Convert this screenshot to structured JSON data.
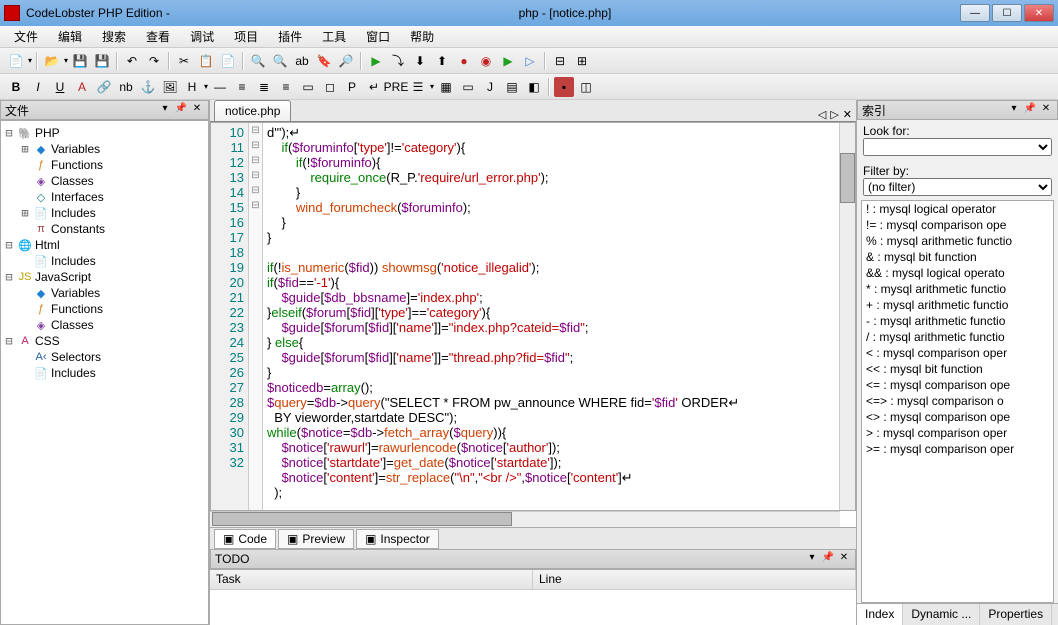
{
  "titlebar": {
    "app_name": "CodeLobster PHP Edition -",
    "doc_title": "php - [notice.php]"
  },
  "menu": [
    "文件",
    "编辑",
    "搜索",
    "查看",
    "调试",
    "项目",
    "插件",
    "工具",
    "窗口",
    "帮助"
  ],
  "left_panel": {
    "title": "文件",
    "tree": [
      {
        "level": 0,
        "exp": "-",
        "icon": "php",
        "label": "PHP"
      },
      {
        "level": 1,
        "exp": "+",
        "icon": "var",
        "label": "Variables"
      },
      {
        "level": 1,
        "exp": "",
        "icon": "func",
        "label": "Functions"
      },
      {
        "level": 1,
        "exp": "",
        "icon": "class",
        "label": "Classes"
      },
      {
        "level": 1,
        "exp": "",
        "icon": "intf",
        "label": "Interfaces"
      },
      {
        "level": 1,
        "exp": "+",
        "icon": "inc",
        "label": "Includes"
      },
      {
        "level": 1,
        "exp": "",
        "icon": "const",
        "label": "Constants"
      },
      {
        "level": 0,
        "exp": "-",
        "icon": "html",
        "label": "Html"
      },
      {
        "level": 1,
        "exp": "",
        "icon": "inc",
        "label": "Includes"
      },
      {
        "level": 0,
        "exp": "-",
        "icon": "js",
        "label": "JavaScript"
      },
      {
        "level": 1,
        "exp": "",
        "icon": "var",
        "label": "Variables"
      },
      {
        "level": 1,
        "exp": "",
        "icon": "func",
        "label": "Functions"
      },
      {
        "level": 1,
        "exp": "",
        "icon": "class",
        "label": "Classes"
      },
      {
        "level": 0,
        "exp": "-",
        "icon": "css",
        "label": "CSS"
      },
      {
        "level": 1,
        "exp": "",
        "icon": "sel",
        "label": "Selectors"
      },
      {
        "level": 1,
        "exp": "",
        "icon": "inc",
        "label": "Includes"
      }
    ]
  },
  "editor": {
    "tab": "notice.php",
    "first_line": 10,
    "lines": [
      {
        "n": 10,
        "fold": "",
        "html": "d'\");↵"
      },
      {
        "n": 11,
        "fold": "-",
        "html": "    if($foruminfo['type']!='category'){"
      },
      {
        "n": 12,
        "fold": "-",
        "html": "        if(!$foruminfo){"
      },
      {
        "n": 13,
        "fold": "",
        "html": "            require_once(R_P.'require/url_error.php');"
      },
      {
        "n": 14,
        "fold": "",
        "html": "        }"
      },
      {
        "n": 15,
        "fold": "",
        "html": "        wind_forumcheck($foruminfo);"
      },
      {
        "n": 16,
        "fold": "",
        "html": "    }"
      },
      {
        "n": 17,
        "fold": "",
        "html": "}"
      },
      {
        "n": 18,
        "fold": "",
        "html": ""
      },
      {
        "n": 19,
        "fold": "",
        "html": "if(!is_numeric($fid)) showmsg('notice_illegalid');"
      },
      {
        "n": 20,
        "fold": "-",
        "html": "if($fid=='-1'){"
      },
      {
        "n": 21,
        "fold": "",
        "html": "    $guide[$db_bbsname]='index.php';"
      },
      {
        "n": 22,
        "fold": "-",
        "html": "}elseif($forum[$fid]['type']=='category'){"
      },
      {
        "n": 23,
        "fold": "",
        "html": "    $guide[$forum[$fid]['name']]=\"index.php?cateid=$fid\";"
      },
      {
        "n": 24,
        "fold": "-",
        "html": "} else{"
      },
      {
        "n": 25,
        "fold": "",
        "html": "    $guide[$forum[$fid]['name']]=\"thread.php?fid=$fid\";"
      },
      {
        "n": 26,
        "fold": "",
        "html": "}"
      },
      {
        "n": 27,
        "fold": "",
        "html": "$noticedb=array();"
      },
      {
        "n": 28,
        "fold": "",
        "html": "$query=$db->query(\"SELECT * FROM pw_announce WHERE fid='$fid' ORDER↵"
      },
      {
        "n": "",
        "fold": "",
        "html": "  BY vieworder,startdate DESC\");"
      },
      {
        "n": 29,
        "fold": "-",
        "html": "while($notice=$db->fetch_array($query)){"
      },
      {
        "n": 30,
        "fold": "",
        "html": "    $notice['rawurl']=rawurlencode($notice['author']);"
      },
      {
        "n": 31,
        "fold": "",
        "html": "    $notice['startdate']=get_date($notice['startdate']);"
      },
      {
        "n": 32,
        "fold": "",
        "html": "    $notice['content']=str_replace(\"\\n\",\"<br />\",$notice['content']↵"
      },
      {
        "n": "",
        "fold": "",
        "html": "  );"
      }
    ],
    "bottom_tabs": [
      {
        "label": "Code",
        "active": true
      },
      {
        "label": "Preview",
        "active": false
      },
      {
        "label": "Inspector",
        "active": false
      }
    ]
  },
  "todo": {
    "title": "TODO",
    "columns": [
      "Task",
      "Line"
    ]
  },
  "right_panel": {
    "title": "索引",
    "look_for_label": "Look for:",
    "look_for_value": "",
    "filter_by_label": "Filter by:",
    "filter_by_value": "(no filter)",
    "items": [
      "! : mysql logical operator",
      "!= : mysql comparison ope",
      "% : mysql arithmetic functio",
      "& : mysql bit function",
      "&& : mysql logical operato",
      "* : mysql arithmetic functio",
      "+ : mysql arithmetic functio",
      "- : mysql arithmetic functio",
      "/ : mysql arithmetic functio",
      "< : mysql comparison oper",
      "<< : mysql bit function",
      "<= : mysql comparison ope",
      "<=> : mysql comparison o",
      "<> : mysql comparison ope",
      "> : mysql comparison oper",
      ">= : mysql comparison oper"
    ],
    "bottom_tabs": [
      "Index",
      "Dynamic ...",
      "Properties"
    ]
  }
}
